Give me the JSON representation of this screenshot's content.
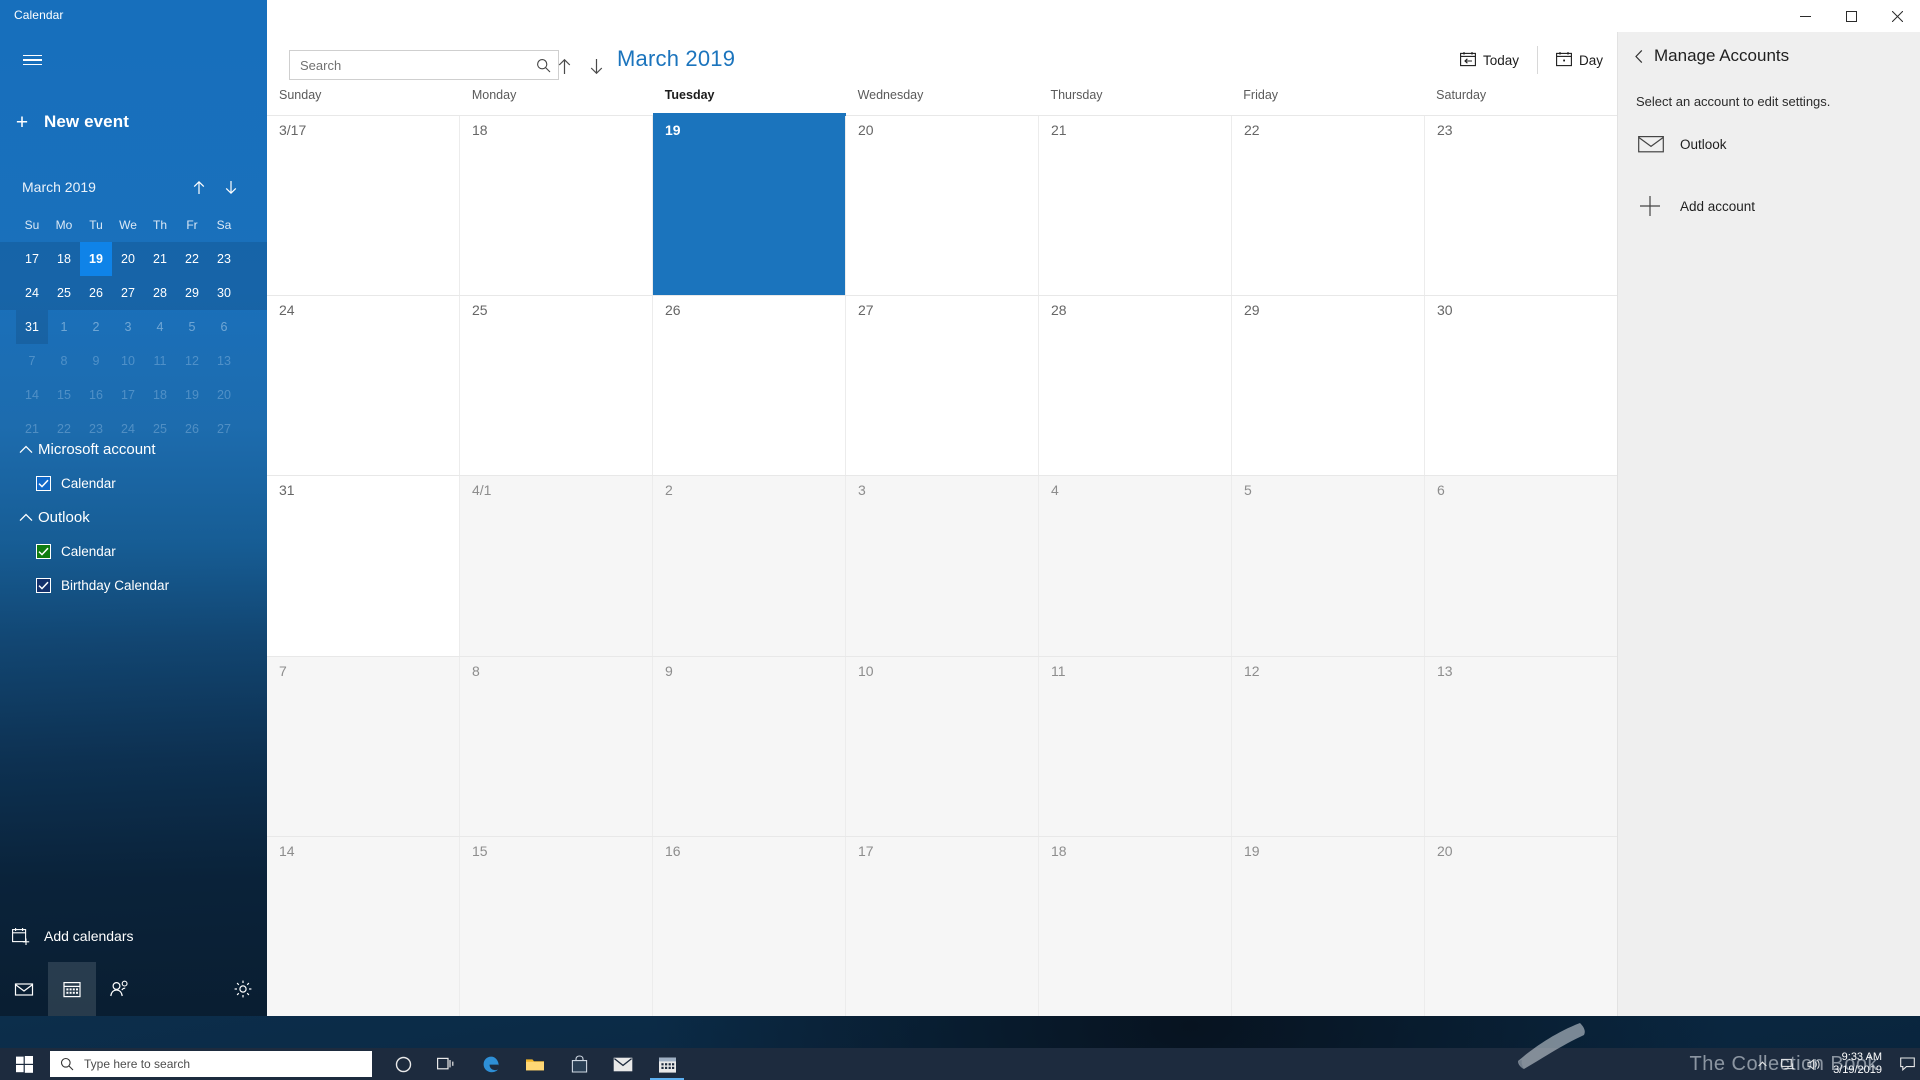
{
  "window": {
    "app_title": "Calendar",
    "controls": {
      "minimize": "minimize-icon",
      "maximize": "maximize-icon",
      "close": "close-icon"
    }
  },
  "nav": {
    "menu_icon": "hamburger-icon",
    "new_event_label": "New event",
    "new_event_icon": "plus-icon",
    "mini_calendar": {
      "month_label": "March 2019",
      "prev_icon": "arrow-up-icon",
      "next_icon": "arrow-down-icon",
      "dow": [
        "Su",
        "Mo",
        "Tu",
        "We",
        "Th",
        "Fr",
        "Sa"
      ],
      "weeks": [
        {
          "band": true,
          "days": [
            {
              "n": "17",
              "state": "in"
            },
            {
              "n": "18",
              "state": "in"
            },
            {
              "n": "19",
              "state": "selected"
            },
            {
              "n": "20",
              "state": "in"
            },
            {
              "n": "21",
              "state": "in"
            },
            {
              "n": "22",
              "state": "in"
            },
            {
              "n": "23",
              "state": "in"
            }
          ]
        },
        {
          "band": true,
          "days": [
            {
              "n": "24",
              "state": "in"
            },
            {
              "n": "25",
              "state": "in"
            },
            {
              "n": "26",
              "state": "in"
            },
            {
              "n": "27",
              "state": "in"
            },
            {
              "n": "28",
              "state": "in"
            },
            {
              "n": "29",
              "state": "in"
            },
            {
              "n": "30",
              "state": "in"
            }
          ]
        },
        {
          "band": false,
          "days": [
            {
              "n": "31",
              "state": "in-band"
            },
            {
              "n": "1",
              "state": "out"
            },
            {
              "n": "2",
              "state": "out"
            },
            {
              "n": "3",
              "state": "out"
            },
            {
              "n": "4",
              "state": "out"
            },
            {
              "n": "5",
              "state": "out"
            },
            {
              "n": "6",
              "state": "out"
            }
          ]
        },
        {
          "band": false,
          "days": [
            {
              "n": "7",
              "state": "out2"
            },
            {
              "n": "8",
              "state": "out2"
            },
            {
              "n": "9",
              "state": "out2"
            },
            {
              "n": "10",
              "state": "out2"
            },
            {
              "n": "11",
              "state": "out2"
            },
            {
              "n": "12",
              "state": "out2"
            },
            {
              "n": "13",
              "state": "out2"
            }
          ]
        },
        {
          "band": false,
          "days": [
            {
              "n": "14",
              "state": "out2"
            },
            {
              "n": "15",
              "state": "out2"
            },
            {
              "n": "16",
              "state": "out2"
            },
            {
              "n": "17",
              "state": "out2"
            },
            {
              "n": "18",
              "state": "out2"
            },
            {
              "n": "19",
              "state": "out2"
            },
            {
              "n": "20",
              "state": "out2"
            }
          ]
        },
        {
          "band": false,
          "days": [
            {
              "n": "21",
              "state": "out2"
            },
            {
              "n": "22",
              "state": "out2"
            },
            {
              "n": "23",
              "state": "out2"
            },
            {
              "n": "24",
              "state": "out2"
            },
            {
              "n": "25",
              "state": "out2"
            },
            {
              "n": "26",
              "state": "out2"
            },
            {
              "n": "27",
              "state": "out2"
            }
          ]
        }
      ]
    },
    "accounts": [
      {
        "name": "Microsoft account",
        "chevron": "chevron-up-icon",
        "calendars": [
          {
            "label": "Calendar",
            "checked": true,
            "color": "#1168c8"
          }
        ]
      },
      {
        "name": "Outlook",
        "chevron": "chevron-up-icon",
        "calendars": [
          {
            "label": "Calendar",
            "checked": true,
            "color": "#107c10"
          },
          {
            "label": "Birthday Calendar",
            "checked": true,
            "color": "#14306b"
          }
        ]
      }
    ],
    "add_calendars_label": "Add calendars",
    "add_calendars_icon": "calendar-add-icon",
    "app_bar": [
      {
        "name": "mail-icon",
        "label": "Mail",
        "active": false
      },
      {
        "name": "calendar-icon",
        "label": "Calendar",
        "active": true
      },
      {
        "name": "people-icon",
        "label": "People",
        "active": false
      },
      {
        "name": "settings-gear-icon",
        "label": "Settings",
        "active": false
      }
    ]
  },
  "toolbar": {
    "search_placeholder": "Search",
    "search_value": "",
    "search_icon": "search-icon",
    "prev_icon": "arrow-up-icon",
    "next_icon": "arrow-down-icon",
    "month_title": "March 2019",
    "today_label": "Today",
    "today_icon": "calendar-today-icon",
    "view_label": "Day",
    "view_icon": "calendar-day-icon"
  },
  "calendar_grid": {
    "day_headers": [
      "Sunday",
      "Monday",
      "Tuesday",
      "Wednesday",
      "Thursday",
      "Friday",
      "Saturday"
    ],
    "today_column_index": 2,
    "rows": [
      [
        {
          "label": "3/17",
          "state": "current"
        },
        {
          "label": "18",
          "state": "current"
        },
        {
          "label": "19",
          "state": "selected"
        },
        {
          "label": "20",
          "state": "current"
        },
        {
          "label": "21",
          "state": "current"
        },
        {
          "label": "22",
          "state": "current"
        },
        {
          "label": "23",
          "state": "current"
        }
      ],
      [
        {
          "label": "24",
          "state": "current"
        },
        {
          "label": "25",
          "state": "current"
        },
        {
          "label": "26",
          "state": "current"
        },
        {
          "label": "27",
          "state": "current"
        },
        {
          "label": "28",
          "state": "current"
        },
        {
          "label": "29",
          "state": "current"
        },
        {
          "label": "30",
          "state": "current"
        }
      ],
      [
        {
          "label": "31",
          "state": "current"
        },
        {
          "label": "4/1",
          "state": "other"
        },
        {
          "label": "2",
          "state": "other"
        },
        {
          "label": "3",
          "state": "other"
        },
        {
          "label": "4",
          "state": "other"
        },
        {
          "label": "5",
          "state": "other"
        },
        {
          "label": "6",
          "state": "other"
        }
      ],
      [
        {
          "label": "7",
          "state": "other"
        },
        {
          "label": "8",
          "state": "other"
        },
        {
          "label": "9",
          "state": "other"
        },
        {
          "label": "10",
          "state": "other"
        },
        {
          "label": "11",
          "state": "other"
        },
        {
          "label": "12",
          "state": "other"
        },
        {
          "label": "13",
          "state": "other"
        }
      ],
      [
        {
          "label": "14",
          "state": "other"
        },
        {
          "label": "15",
          "state": "other"
        },
        {
          "label": "16",
          "state": "other"
        },
        {
          "label": "17",
          "state": "other"
        },
        {
          "label": "18",
          "state": "other"
        },
        {
          "label": "19",
          "state": "other"
        },
        {
          "label": "20",
          "state": "other"
        }
      ]
    ]
  },
  "right_panel": {
    "back_icon": "chevron-left-icon",
    "title": "Manage Accounts",
    "subtitle": "Select an account to edit settings.",
    "accounts": [
      {
        "label": "Outlook",
        "icon": "envelope-icon"
      }
    ],
    "add_account_label": "Add account",
    "add_account_icon": "plus-icon"
  },
  "taskbar": {
    "start_icon": "windows-start-icon",
    "search_placeholder": "Type here to search",
    "search_icon": "search-icon",
    "items": [
      {
        "name": "cortana-icon",
        "active": false
      },
      {
        "name": "task-view-icon",
        "active": false
      },
      {
        "name": "edge-icon",
        "active": false
      },
      {
        "name": "file-explorer-icon",
        "active": false
      },
      {
        "name": "store-icon",
        "active": false
      },
      {
        "name": "mail-icon",
        "active": false
      },
      {
        "name": "calendar-icon",
        "active": true
      }
    ],
    "tray": [
      {
        "name": "show-hidden-icons-chevron"
      },
      {
        "name": "network-icon"
      },
      {
        "name": "volume-icon"
      },
      {
        "name": "action-center-icon"
      }
    ],
    "time": "9:33 AM",
    "date": "3/19/2019"
  },
  "watermark": {
    "text": "The Collection Book"
  },
  "colors": {
    "accent_blue": "#176fbc",
    "selected_blue": "#1b74bd",
    "mini_selected": "#0f83e8",
    "title_blue": "#1b74bd",
    "panel_gray": "#efefef",
    "taskbar": "#1d2b3e"
  }
}
